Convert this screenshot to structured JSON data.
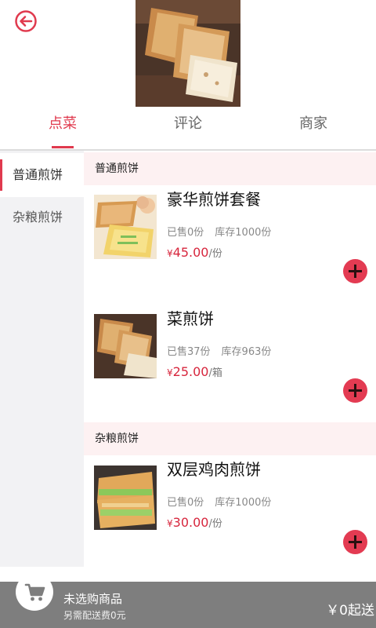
{
  "tabs": [
    {
      "label": "点菜",
      "active": true
    },
    {
      "label": "评论",
      "active": false
    },
    {
      "label": "商家",
      "active": false
    }
  ],
  "sidebar": {
    "items": [
      {
        "label": "普通煎饼",
        "active": true
      },
      {
        "label": "杂粮煎饼",
        "active": false
      }
    ]
  },
  "sections": [
    {
      "title": "普通煎饼",
      "products": [
        {
          "name": "豪华煎饼套餐",
          "sold": "已售0份",
          "stock": "库存1000份",
          "currency": "¥",
          "price": "45.00",
          "unit": "/份"
        },
        {
          "name": "菜煎饼",
          "sold": "已售37份",
          "stock": "库存963份",
          "currency": "¥",
          "price": "25.00",
          "unit": "/箱"
        }
      ]
    },
    {
      "title": "杂粮煎饼",
      "products": [
        {
          "name": "双层鸡肉煎饼",
          "sold": "已售0份",
          "stock": "库存1000份",
          "currency": "¥",
          "price": "30.00",
          "unit": "/份"
        }
      ]
    }
  ],
  "cart": {
    "title": "未选购商品",
    "delivery_note": "另需配送费0元",
    "min_order": "￥0起送"
  },
  "colors": {
    "accent": "#e03a4e",
    "price": "#d7263d",
    "add_button": "#e33b52",
    "cart_bar": "#7e7e7e"
  },
  "icons": [
    "back-arrow-icon",
    "add-icon",
    "cart-icon"
  ]
}
